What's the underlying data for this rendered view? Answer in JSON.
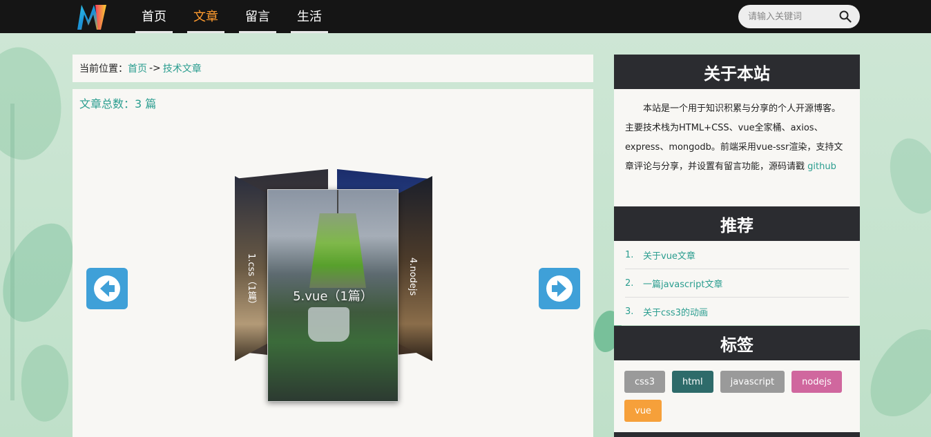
{
  "header": {
    "nav": [
      {
        "label": "首页",
        "active": false
      },
      {
        "label": "文章",
        "active": true
      },
      {
        "label": "留言",
        "active": false
      },
      {
        "label": "生活",
        "active": false
      }
    ],
    "search_placeholder": "请输入关键词"
  },
  "breadcrumb": {
    "prefix": "当前位置：",
    "home": "首页",
    "separator": "->",
    "current": "技术文章"
  },
  "main": {
    "article_count": "文章总数：3 篇",
    "carousel": {
      "front_title": "5.vue（1篇）",
      "left_label": "1.css（1篇）",
      "right_label": "4.nodejs"
    }
  },
  "sidebar": {
    "about": {
      "title": "关于本站",
      "text": "本站是一个用于知识积累与分享的个人开源博客。主要技术栈为HTML+CSS、vue全家桶、axios、express、mongodb。前端采用vue-ssr渲染，支持文章评论与分享，并设置有留言功能，源码请戳 ",
      "link": "github"
    },
    "recommend": {
      "title": "推荐",
      "items": [
        {
          "num": "1.",
          "label": "关于vue文章"
        },
        {
          "num": "2.",
          "label": "一篇javascript文章"
        },
        {
          "num": "3.",
          "label": "关于css3的动画"
        }
      ]
    },
    "tags": {
      "title": "标签",
      "items": [
        {
          "label": "css3",
          "color": "#9a9a9a"
        },
        {
          "label": "html",
          "color": "#2e6b6a"
        },
        {
          "label": "javascript",
          "color": "#9a9a9a"
        },
        {
          "label": "nodejs",
          "color": "#d0679e"
        },
        {
          "label": "vue",
          "color": "#f6a03a"
        }
      ]
    }
  },
  "colors": {
    "accent_orange": "#ff9b2e",
    "link_teal": "#2a9d8f",
    "arrow_blue": "#3fa0d8",
    "dark_header": "#2b2c30"
  }
}
